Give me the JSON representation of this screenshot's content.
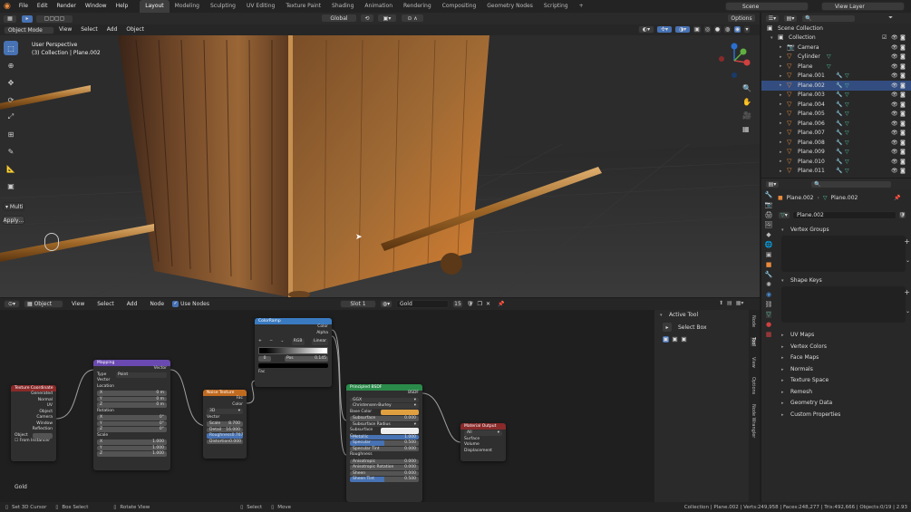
{
  "topbar": {
    "menus": [
      "File",
      "Edit",
      "Render",
      "Window",
      "Help"
    ],
    "workspaces": [
      "Layout",
      "Modeling",
      "Sculpting",
      "UV Editing",
      "Texture Paint",
      "Shading",
      "Animation",
      "Rendering",
      "Compositing",
      "Geometry Nodes",
      "Scripting"
    ],
    "active_workspace": "Layout",
    "scene": "Scene",
    "view_layer": "View Layer"
  },
  "viewport": {
    "mode": "Object Mode",
    "menus": [
      "View",
      "Select",
      "Add",
      "Object"
    ],
    "transform": "Global",
    "options": "Options",
    "overlay_title": "User Perspective",
    "overlay_sub": "(3) Collection | Plane.002",
    "last_op": "Multi",
    "last_op_btn": "Apply"
  },
  "outliner": {
    "root": "Scene Collection",
    "collection": "Collection",
    "items": [
      "Camera",
      "Cylinder",
      "Plane",
      "Plane.001",
      "Plane.002",
      "Plane.003",
      "Plane.004",
      "Plane.005",
      "Plane.006",
      "Plane.007",
      "Plane.008",
      "Plane.009",
      "Plane.010",
      "Plane.011"
    ]
  },
  "properties": {
    "object_name": "Plane.002",
    "mesh_name": "Plane.002",
    "data_name": "Plane.002",
    "sections": [
      "Vertex Groups",
      "Shape Keys",
      "UV Maps",
      "Vertex Colors",
      "Face Maps",
      "Normals",
      "Texture Space",
      "Remesh",
      "Geometry Data",
      "Custom Properties"
    ]
  },
  "node_editor": {
    "type": "Object",
    "menus": [
      "View",
      "Select",
      "Add",
      "Node"
    ],
    "use_nodes": "Use Nodes",
    "slot": "Slot 1",
    "material": "Gold",
    "users": "15",
    "frame_label": "Gold",
    "sidebar_title": "Active Tool",
    "sidebar_tool": "Select Box",
    "sidebar_tabs": [
      "Node",
      "Tool",
      "View",
      "Options",
      "Node Wrangler"
    ]
  },
  "nodes": {
    "texcoord": {
      "title": "Texture Coordinate",
      "outputs": [
        "Generated",
        "Normal",
        "UV",
        "Object",
        "Camera",
        "Window",
        "Reflection"
      ],
      "object": "Object",
      "from_instancer": "From Instancer"
    },
    "mapping": {
      "title": "Mapping",
      "type_label": "Type",
      "type_value": "Point",
      "out": "Vector",
      "in": "Vector",
      "loc": "Location",
      "rot": "Rotation",
      "scale": "Scale",
      "loc_vals": [
        "0 m",
        "0 m",
        "0 m"
      ],
      "rot_vals": [
        "0°",
        "0°",
        "0°"
      ],
      "scale_vals": [
        "1.000",
        "1.000",
        "1.000"
      ],
      "axes": [
        "X",
        "Y",
        "Z"
      ]
    },
    "noise": {
      "title": "Noise Texture",
      "outputs": [
        "Fac",
        "Color"
      ],
      "dim": "3D",
      "vector": "Vector",
      "scale": "Scale",
      "scale_v": "8.700",
      "detail": "Detail",
      "detail_v": "16.000",
      "rough": "Roughness",
      "rough_v": "0.767",
      "distortion": "Distortion",
      "distortion_v": "0.000"
    },
    "ramp": {
      "title": "ColorRamp",
      "outputs": [
        "Color",
        "Alpha"
      ],
      "mode": "RGB",
      "interp": "Linear",
      "pos_label": "Pos",
      "pos_val": "0.145",
      "idx": "0",
      "fac": "Fac"
    },
    "bsdf": {
      "title": "Principled BSDF",
      "output": "BSDF",
      "dist": "GGX",
      "sss": "Christensen-Burley",
      "rows": [
        [
          "Base Color",
          ""
        ],
        [
          "Subsurface",
          "0.000"
        ],
        [
          "Subsurface Radius",
          ""
        ],
        [
          "Subsurface C...",
          ""
        ],
        [
          "Metallic",
          "1.000"
        ],
        [
          "Specular",
          "0.500"
        ],
        [
          "Specular Tint",
          "0.000"
        ],
        [
          "Roughness",
          ""
        ],
        [
          "Anisotropic",
          "0.000"
        ],
        [
          "Anisotropic Rotation",
          "0.000"
        ],
        [
          "Sheen",
          "0.000"
        ],
        [
          "Sheen Tint",
          "0.500"
        ]
      ]
    },
    "output": {
      "title": "Material Output",
      "target": "All",
      "inputs": [
        "Surface",
        "Volume",
        "Displacement"
      ]
    }
  },
  "status": {
    "items": [
      "Set 3D Cursor",
      "Box Select",
      "Rotate View",
      "Select",
      "Move"
    ],
    "stats": "Collection | Plane.002 | Verts:249,958 | Faces:248,277 | Tris:492,666 | Objects:0/19 | 2.93"
  },
  "colors": {
    "accent": "#4772b3",
    "orange": "#e88a3c",
    "gold": "#e0a040"
  }
}
